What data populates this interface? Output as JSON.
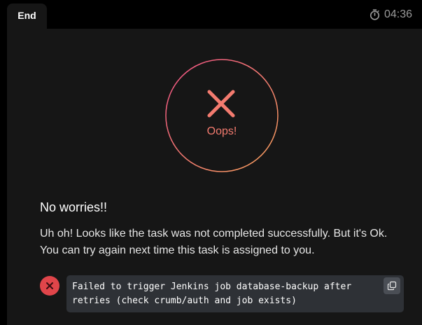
{
  "header": {
    "tab_label": "End",
    "timer": "04:36",
    "timer_icon": "stopwatch-icon"
  },
  "result": {
    "status_label": "Oops!",
    "status_icon": "x-mark-icon",
    "ring_gradient": [
      "#ef4f86",
      "#f7a35c"
    ],
    "accent_color": "#f37b6f"
  },
  "content": {
    "heading": "No worries!!",
    "message": "Uh oh! Looks like the task was not completed successfully. But it's Ok. You can try again next time this task is assigned to you."
  },
  "error": {
    "icon": "error-x-icon",
    "badge_color": "#e0454a",
    "text": "Failed to trigger Jenkins job database-backup after retries (check crumb/auth and job exists)",
    "copy_icon": "copy-icon"
  }
}
